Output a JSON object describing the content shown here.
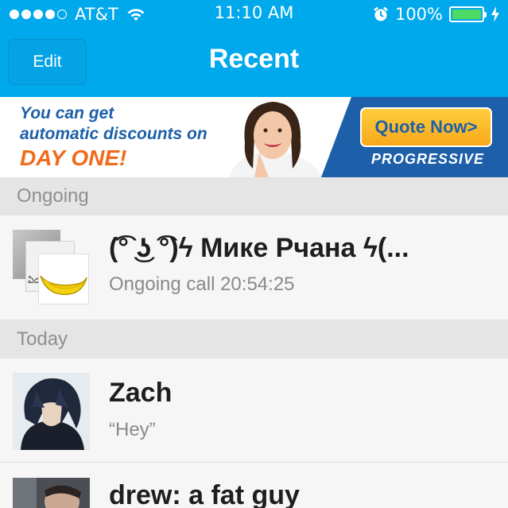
{
  "status_bar": {
    "carrier": "AT&T",
    "time": "11:10 AM",
    "battery": "100%",
    "signal_bars_filled": 4,
    "signal_bars_total": 5
  },
  "nav": {
    "edit_label": "Edit",
    "title": "Recent"
  },
  "ad": {
    "line1": "You can get",
    "line2": "automatic discounts on",
    "line3": "DAY ONE!",
    "cta": "Quote Now>",
    "brand": "PROGRESSIVE"
  },
  "sections": [
    {
      "header": "Ongoing",
      "items": [
        {
          "title": "(͡° ͜ʖ ͡°)ϟ Мике Рчана ϟ(...",
          "subtitle": "Ongoing call 20:54:25",
          "avatar_text": "ఏడు 80"
        }
      ]
    },
    {
      "header": "Today",
      "items": [
        {
          "title": "Zach",
          "subtitle": "“Hey”"
        },
        {
          "title": "drew: a fat guy",
          "subtitle": ""
        }
      ]
    }
  ],
  "colors": {
    "nav_blue": "#00a8ec",
    "battery_green": "#4cd964",
    "ad_blue": "#1d5fa8",
    "ad_orange": "#f26a1b"
  }
}
